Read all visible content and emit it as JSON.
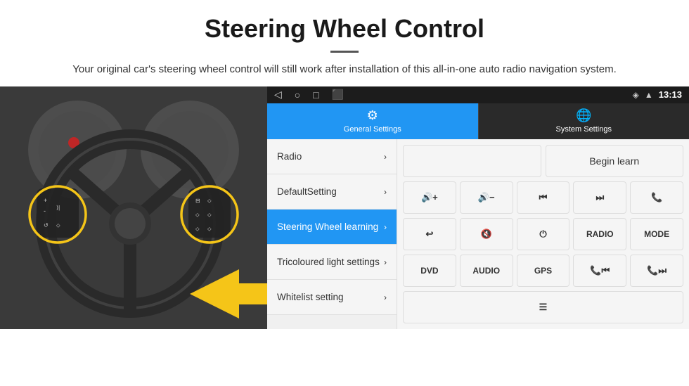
{
  "header": {
    "title": "Steering Wheel Control",
    "description": "Your original car's steering wheel control will still work after installation of this all-in-one auto radio navigation system."
  },
  "status_bar": {
    "time": "13:13",
    "icons": [
      "◁",
      "○",
      "□",
      "⬛"
    ]
  },
  "tabs": {
    "general": {
      "label": "General Settings",
      "icon": "⚙"
    },
    "system": {
      "label": "System Settings",
      "icon": "🌐"
    }
  },
  "menu_items": [
    {
      "label": "Radio",
      "active": false
    },
    {
      "label": "DefaultSetting",
      "active": false
    },
    {
      "label": "Steering Wheel learning",
      "active": true
    },
    {
      "label": "Tricoloured light settings",
      "active": false
    },
    {
      "label": "Whitelist setting",
      "active": false
    }
  ],
  "controls": {
    "begin_learn": "Begin learn",
    "row1": [
      "🔊+",
      "🔊−",
      "⏮",
      "⏭",
      "📞"
    ],
    "row2": [
      "↩",
      "🔊✕",
      "⏻",
      "RADIO",
      "MODE"
    ],
    "row3": [
      "DVD",
      "AUDIO",
      "GPS",
      "📞⏮",
      "📞⏭"
    ],
    "row4_icon": "≡"
  }
}
